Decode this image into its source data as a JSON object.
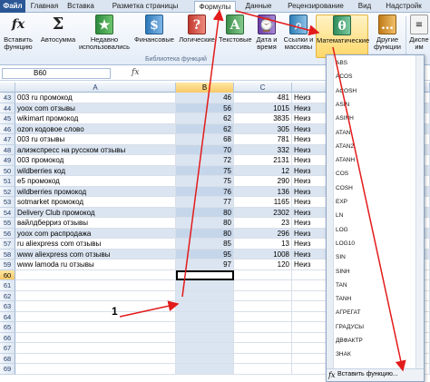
{
  "tabs": [
    {
      "label": "Файл"
    },
    {
      "label": "Главная"
    },
    {
      "label": "Вставка"
    },
    {
      "label": "Разметка страницы"
    },
    {
      "label": "Формулы"
    },
    {
      "label": "Данные"
    },
    {
      "label": "Рецензирование"
    },
    {
      "label": "Вид"
    },
    {
      "label": "Надстройк"
    }
  ],
  "ribbon": {
    "insert_function": {
      "line1": "Вставить",
      "line2": "функцию",
      "icon": "fx-icon"
    },
    "autosum": {
      "line1": "Автосумма",
      "line2": "",
      "icon": "sigma-icon"
    },
    "recent": {
      "line1": "Недавно",
      "line2": "использовались",
      "icon": "book-icon"
    },
    "financial": {
      "line1": "Финансовые",
      "line2": "",
      "icon": "book-icon"
    },
    "logical": {
      "line1": "Логические",
      "line2": "",
      "icon": "book-icon"
    },
    "text": {
      "line1": "Текстовые",
      "line2": "",
      "icon": "book-icon"
    },
    "datetime": {
      "line1": "Дата и",
      "line2": "время",
      "icon": "book-icon"
    },
    "lookup": {
      "line1": "Ссылки и",
      "line2": "массивы",
      "icon": "book-icon"
    },
    "math": {
      "line1": "Математические",
      "line2": "",
      "icon": "theta-book-icon"
    },
    "other": {
      "line1": "Другие",
      "line2": "функции",
      "icon": "book-icon"
    },
    "name_manager": {
      "line1": "Диспе",
      "line2": "им",
      "icon": "name-manager-icon"
    },
    "group_label": "Библиотека функций"
  },
  "formula_bar": {
    "name_box": "B60",
    "fx": "fx"
  },
  "columns": [
    "A",
    "B",
    "C",
    "D"
  ],
  "rows": [
    {
      "n": "43",
      "a": "003 ru промокод",
      "b": "46",
      "c": "481",
      "d": "Неиз"
    },
    {
      "n": "44",
      "a": "yoox com отзывы",
      "b": "56",
      "c": "1015",
      "d": "Неиз"
    },
    {
      "n": "45",
      "a": "wikimart промокод",
      "b": "62",
      "c": "3835",
      "d": "Неиз"
    },
    {
      "n": "46",
      "a": "ozon кодовое слово",
      "b": "62",
      "c": "305",
      "d": "Неиз"
    },
    {
      "n": "47",
      "a": "003 ru отзывы",
      "b": "68",
      "c": "781",
      "d": "Неиз"
    },
    {
      "n": "48",
      "a": "алиэкспресс на русском отзывы",
      "b": "70",
      "c": "332",
      "d": "Неиз"
    },
    {
      "n": "49",
      "a": "003 промокод",
      "b": "72",
      "c": "2131",
      "d": "Неиз"
    },
    {
      "n": "50",
      "a": "wildberries код",
      "b": "75",
      "c": "12",
      "d": "Неиз"
    },
    {
      "n": "51",
      "a": "e5 промокод",
      "b": "75",
      "c": "290",
      "d": "Неиз"
    },
    {
      "n": "52",
      "a": "wildberries промокод",
      "b": "76",
      "c": "136",
      "d": "Неиз"
    },
    {
      "n": "53",
      "a": "sotmarket промокод",
      "b": "77",
      "c": "1165",
      "d": "Неиз"
    },
    {
      "n": "54",
      "a": "Delivery Club промокод",
      "b": "80",
      "c": "2302",
      "d": "Неиз"
    },
    {
      "n": "55",
      "a": "вайлдберриз отзывы",
      "b": "80",
      "c": "23",
      "d": "Неиз"
    },
    {
      "n": "56",
      "a": "yoox com распродажа",
      "b": "80",
      "c": "296",
      "d": "Неиз"
    },
    {
      "n": "57",
      "a": "ru aliexpress com отзывы",
      "b": "85",
      "c": "13",
      "d": "Неиз"
    },
    {
      "n": "58",
      "a": "www aliexpress com отзывы",
      "b": "95",
      "c": "1008",
      "d": "Неиз"
    },
    {
      "n": "59",
      "a": "www lamoda ru отзывы",
      "b": "97",
      "c": "120",
      "d": "Неиз"
    },
    {
      "n": "60",
      "a": "",
      "b": "",
      "c": "",
      "d": ""
    },
    {
      "n": "61",
      "a": "",
      "b": "",
      "c": "",
      "d": ""
    },
    {
      "n": "62",
      "a": "",
      "b": "",
      "c": "",
      "d": ""
    },
    {
      "n": "63",
      "a": "",
      "b": "",
      "c": "",
      "d": ""
    },
    {
      "n": "64",
      "a": "",
      "b": "",
      "c": "",
      "d": ""
    },
    {
      "n": "65",
      "a": "",
      "b": "",
      "c": "",
      "d": ""
    },
    {
      "n": "66",
      "a": "",
      "b": "",
      "c": "",
      "d": ""
    },
    {
      "n": "67",
      "a": "",
      "b": "",
      "c": "",
      "d": ""
    },
    {
      "n": "68",
      "a": "",
      "b": "",
      "c": "",
      "d": ""
    },
    {
      "n": "69",
      "a": "",
      "b": "",
      "c": "",
      "d": ""
    }
  ],
  "dropdown": {
    "items": [
      "ABS",
      "ACOS",
      "ACOSH",
      "ASIN",
      "ASINH",
      "ATAN",
      "ATAN2",
      "ATANH",
      "COS",
      "COSH",
      "EXP",
      "LN",
      "LOG",
      "LOG10",
      "SIN",
      "SINH",
      "TAN",
      "TANH",
      "АГРЕГАТ",
      "ГРАДУСЫ",
      "ДВФАКТР",
      "ЗНАК"
    ],
    "footer": "Вставить функцию..."
  },
  "annotation": {
    "label": "1",
    "color": "#e21b1b"
  },
  "colors": {
    "accent": "#2b5797",
    "arrow": "#e21b1b",
    "band": "#dbe5f1"
  }
}
